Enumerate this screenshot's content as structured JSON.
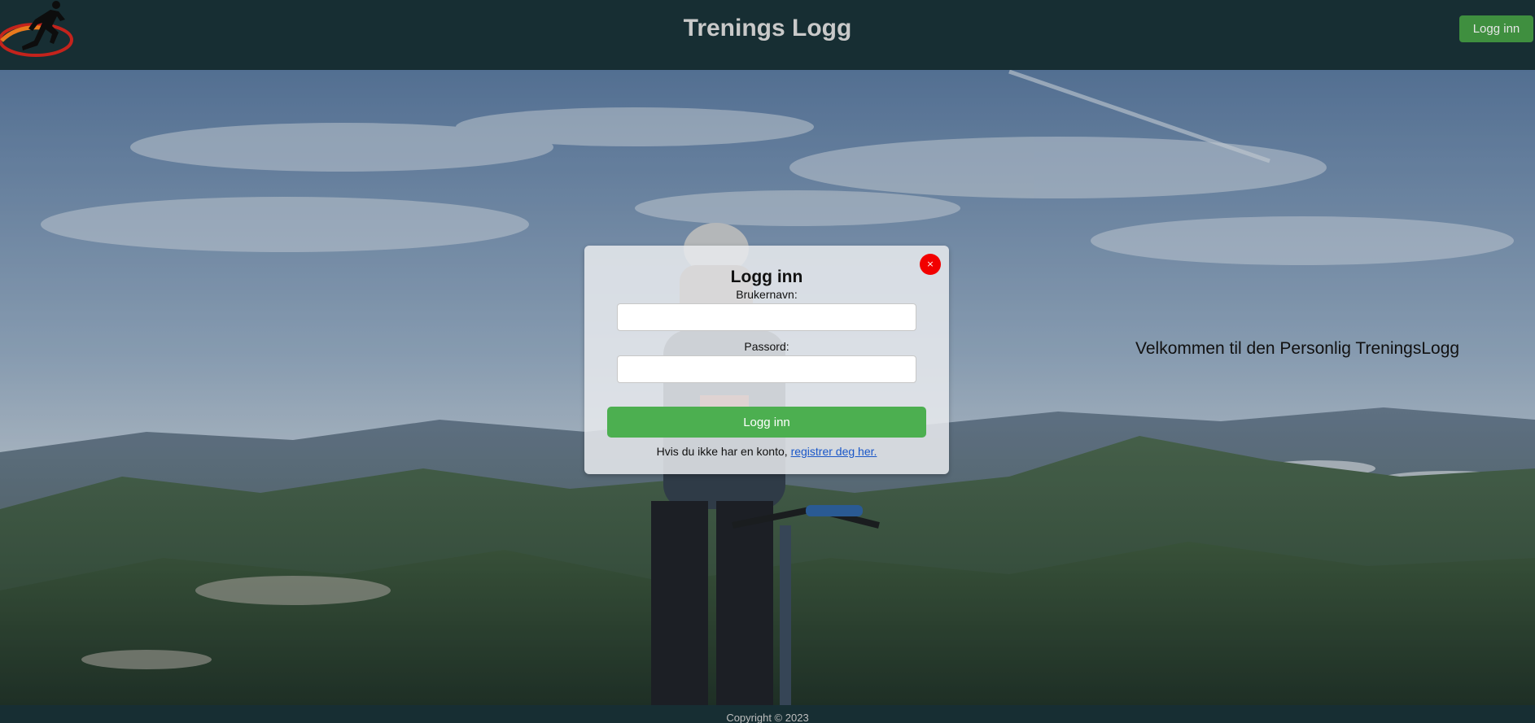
{
  "header": {
    "title": "Trenings Logg",
    "login_button": "Logg inn",
    "logo_icon": "running-man-logo",
    "background_color": "#172e33"
  },
  "main": {
    "welcome_text": "Velkommen til den Personlig TreningsLogg"
  },
  "login_modal": {
    "close_label": "×",
    "title": "Logg inn",
    "username_label": "Brukernavn:",
    "username_value": "",
    "password_label": "Passord:",
    "password_value": "",
    "submit_label": "Logg inn",
    "register_prompt": "Hvis du ikke har en konto,",
    "register_link": "registrer deg her.",
    "submit_color": "#4caf50",
    "close_color": "#f20000"
  },
  "footer": {
    "copyright": "Copyright © 2023"
  }
}
